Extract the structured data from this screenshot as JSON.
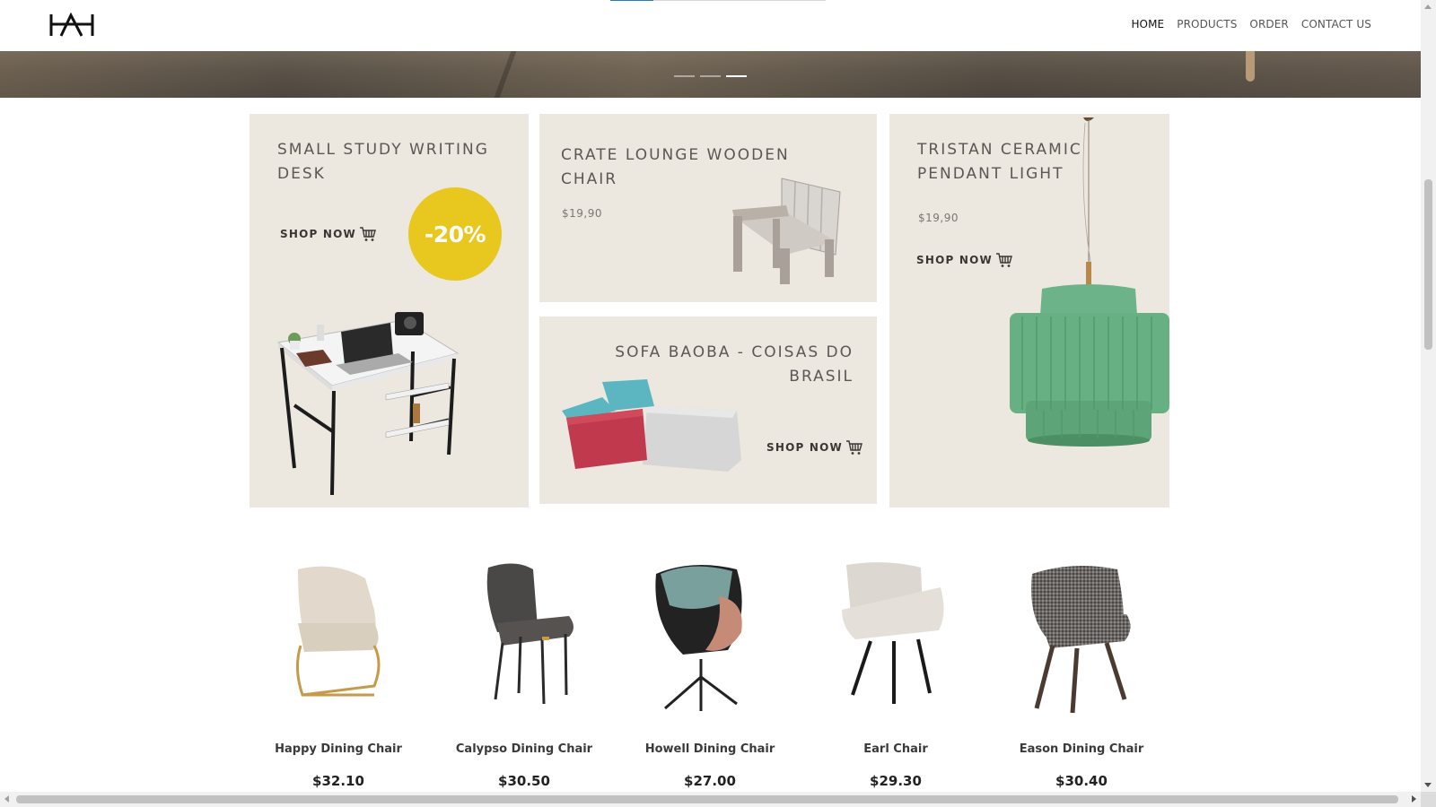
{
  "header": {
    "logo_alt": "HAH",
    "nav": [
      {
        "label": "HOME",
        "active": true
      },
      {
        "label": "PRODUCTS",
        "active": false
      },
      {
        "label": "ORDER",
        "active": false
      },
      {
        "label": "CONTACT US",
        "active": false
      }
    ],
    "scroll_progress": 0.2
  },
  "hero": {
    "slide_count": 3,
    "active_slide": 3
  },
  "promos": {
    "desk": {
      "title": "SMALL STUDY WRITING DESK",
      "shop_label": "SHOP NOW",
      "badge": "-20%"
    },
    "chair": {
      "title": "CRATE LOUNGE WOODEN CHAIR",
      "price": "$19,90"
    },
    "sofa": {
      "title": "SOFA BAOBA - COISAS DO BRASIL",
      "shop_label": "SHOP NOW"
    },
    "pendant": {
      "title": "TRISTAN CERAMIC PENDANT LIGHT",
      "price": "$19,90",
      "shop_label": "SHOP NOW"
    }
  },
  "products": [
    {
      "name": "Happy Dining Chair",
      "price": "$32.10"
    },
    {
      "name": "Calypso Dining Chair",
      "price": "$30.50"
    },
    {
      "name": "Howell Dining Chair",
      "price": "$27.00"
    },
    {
      "name": "Earl Chair",
      "price": "$29.30"
    },
    {
      "name": "Eason Dining Chair",
      "price": "$30.40"
    }
  ],
  "colors": {
    "card_bg": "#ece7df",
    "badge": "#e8c81e",
    "accent": "#2a7fb8"
  },
  "icons": {
    "cart": "cart-icon",
    "logo": "logo-icon"
  }
}
